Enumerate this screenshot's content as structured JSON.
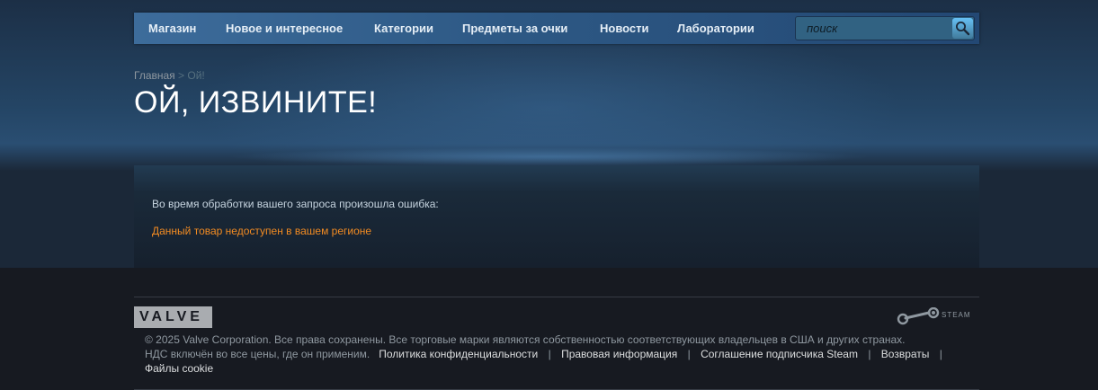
{
  "nav": {
    "tabs": [
      {
        "label": "Магазин"
      },
      {
        "label": "Новое и интересное"
      },
      {
        "label": "Категории"
      },
      {
        "label": "Предметы за очки"
      },
      {
        "label": "Новости"
      },
      {
        "label": "Лаборатории"
      }
    ],
    "search_placeholder": "поиск"
  },
  "breadcrumb": {
    "home": "Главная",
    "separator": ">",
    "current": "Ой!"
  },
  "page": {
    "title": "ОЙ, ИЗВИНИТЕ!"
  },
  "error": {
    "intro": "Во время обработки вашего запроса произошла ошибка:",
    "message": "Данный товар недоступен в вашем регионе"
  },
  "footer": {
    "valve_logo_text": "VALVE",
    "steam_logo_text": "STEAM",
    "copyright": "© 2025 Valve Corporation. Все права сохранены. Все торговые марки являются собственностью соответствующих владельцев в США и других странах.",
    "vat_note": "НДС включён во все цены, где он применим.",
    "links": [
      {
        "label": "Политика конфиденциальности"
      },
      {
        "label": "Правовая информация"
      },
      {
        "label": "Соглашение подписчика Steam"
      },
      {
        "label": "Возвраты"
      },
      {
        "label": "Файлы cookie"
      }
    ],
    "separator": "|"
  },
  "colors": {
    "background": "#1b2838",
    "footer_bg": "#171a21",
    "error_text": "#f28b22",
    "nav_text": "#e5eef6"
  }
}
